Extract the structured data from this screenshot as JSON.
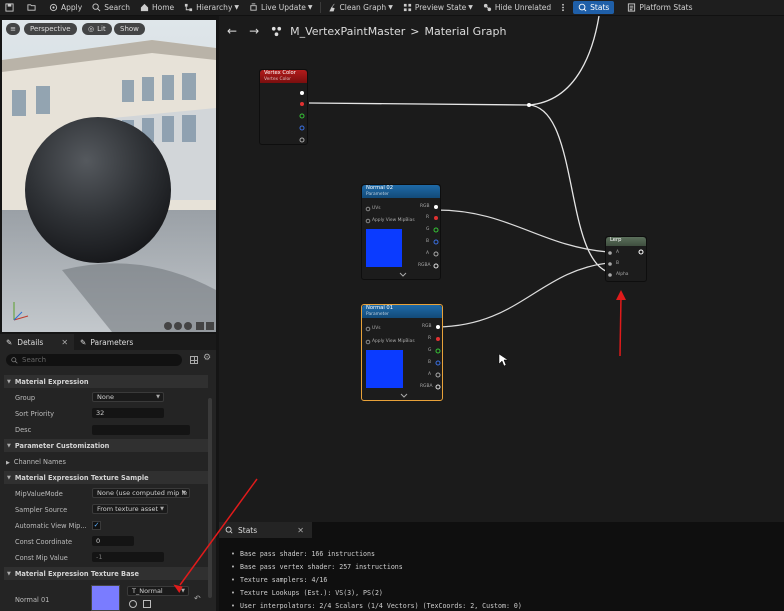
{
  "toolbar": {
    "apply": "Apply",
    "search": "Search",
    "home": "Home",
    "hierarchy": "Hierarchy",
    "live_update": "Live Update",
    "clean_graph": "Clean Graph",
    "preview_state": "Preview State",
    "hide_unrelated": "Hide Unrelated",
    "stats": "Stats",
    "platform_stats": "Platform Stats"
  },
  "viewport": {
    "perspective": "Perspective",
    "lit": "Lit",
    "show": "Show"
  },
  "details": {
    "tab_details": "Details",
    "tab_parameters": "Parameters",
    "search_placeholder": "Search",
    "sec_material_expression": "Material Expression",
    "group_label": "Group",
    "group_value": "None",
    "sort_priority_label": "Sort Priority",
    "sort_priority_value": "32",
    "desc_label": "Desc",
    "sec_parameter_customization": "Parameter Customization",
    "channel_names": "Channel Names",
    "sec_texture_sample": "Material Expression Texture Sample",
    "mip_mode_label": "MipValueMode",
    "mip_mode_value": "None (use computed mip le",
    "sampler_source_label": "Sampler Source",
    "sampler_source_value": "From texture asset",
    "auto_view_mip_label": "Automatic View Mip...",
    "const_coordinate_label": "Const Coordinate",
    "const_coordinate_value": "0",
    "const_mip_label": "Const Mip Value",
    "const_mip_value": "-1",
    "sec_texture_base": "Material Expression Texture Base",
    "normal01_label": "Normal 01",
    "texture_value": "T_Normal"
  },
  "graph": {
    "material_name": "M_VertexPaintMaster",
    "graph_name": "Material Graph",
    "vertex_color": {
      "title": "Vertex Color",
      "subtitle": "Vertex Color"
    },
    "normal02": {
      "title": "Normal 02",
      "subtitle": "Parameter"
    },
    "normal01": {
      "title": "Normal 01",
      "subtitle": "Parameter"
    },
    "uvs": "UVs",
    "apply_view_mip": "Apply View MipBias",
    "pins": {
      "rgb": "RGB",
      "r": "R",
      "g": "G",
      "b": "B",
      "a": "A",
      "rgba": "RGBA",
      "alpha": "Alpha"
    },
    "lerp": "Lerp"
  },
  "stats": {
    "tab": "Stats",
    "lines": [
      "Base pass shader: 166 instructions",
      "Base pass vertex shader: 257 instructions",
      "Texture samplers: 4/16",
      "Texture Lookups (Est.): VS(3), PS(2)",
      "User interpolators: 2/4 Scalars (1/4 Vectors) (TexCoords: 2, Custom: 0)"
    ]
  },
  "colors": {
    "accent": "#1f5fa8",
    "node_selected": "#e8a23a",
    "annotation_arrow": "#e01b1b",
    "texture_preview": "#0b3bff"
  }
}
